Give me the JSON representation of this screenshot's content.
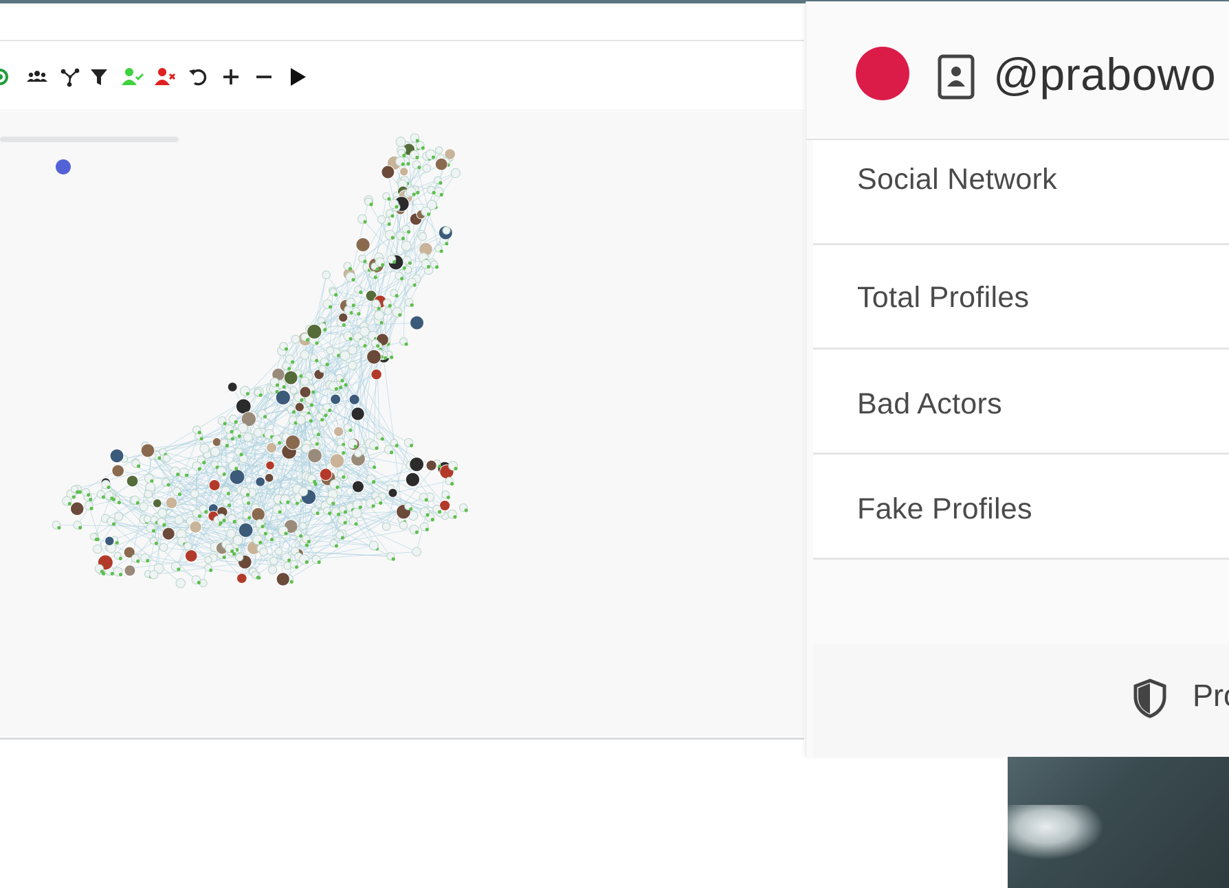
{
  "toolbar": {
    "tools": [
      {
        "name": "community-icon",
        "color": "#1f9d3a"
      },
      {
        "name": "group-icon",
        "color": "#222222"
      },
      {
        "name": "network-icon",
        "color": "#222222"
      },
      {
        "name": "filter-icon",
        "color": "#222222"
      },
      {
        "name": "add-user-icon",
        "color": "#3fd23f"
      },
      {
        "name": "remove-user-icon",
        "color": "#e02020"
      },
      {
        "name": "undo-icon",
        "color": "#222222"
      },
      {
        "name": "zoom-in-icon",
        "color": "#222222"
      },
      {
        "name": "zoom-out-icon",
        "color": "#222222"
      },
      {
        "name": "play-icon",
        "color": "#111111"
      }
    ]
  },
  "timeline": {
    "position": 0.31
  },
  "panel": {
    "status_color": "#dc1c48",
    "handle": "@prabowo",
    "stats": [
      {
        "label": "Social Network"
      },
      {
        "label": "Total Profiles"
      },
      {
        "label": "Bad Actors"
      },
      {
        "label": "Fake Profiles"
      }
    ],
    "footer_label": "Pro"
  },
  "colors": {
    "accent": "#5262d6",
    "node_green": "#5cbf4a",
    "edge": "#a7cfdd",
    "node_fill": "#eef3f3"
  }
}
